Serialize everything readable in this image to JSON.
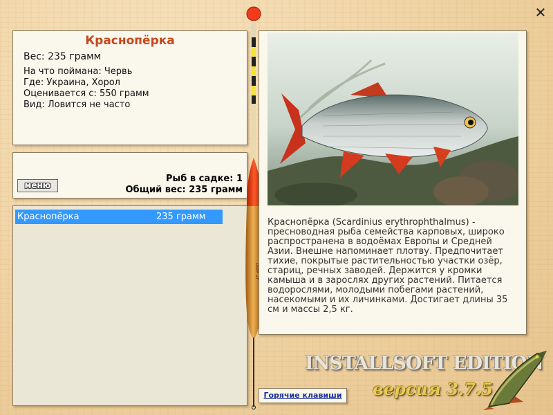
{
  "window": {
    "close_label": "✕"
  },
  "fish_info": {
    "name": "Краснопёрка",
    "weight": "Вес: 235 грамм",
    "caught_on": "На что поймана: Червь",
    "location": "Где: Украина, Хорол",
    "value": "Оценивается с: 550 грамм",
    "rarity": "Вид: Ловится не часто"
  },
  "cage": {
    "menu_label": "меню",
    "fish_count": "Рыб в садке: 1",
    "total_weight": "Общий вес: 235 грамм"
  },
  "catch_list": [
    {
      "name": "Краснопёрка",
      "weight": "235 грамм"
    }
  ],
  "description": "Краснопёрка (Scardinius erythrophthalmus) - пресноводная рыба семейства карповых, широко распространена в водоёмах Европы и Средней Азии. Внешне напоминает плотву. Предпочитает тихие, покрытые растительностью участки озёр, стариц, речных заводей. Держится у кромки камыша и в зарослях других растений. Питается водорослями, молодыми побегами растений, насекомыми и их личинками. Достигает длины 35 см и массы 2,5 кг.",
  "float": {
    "label": "АФР 2г"
  },
  "hotkeys_label": "Горячие клавиши",
  "branding": {
    "title": "INSTALLSOFT EDITION",
    "version": "версия 3.7.5"
  }
}
